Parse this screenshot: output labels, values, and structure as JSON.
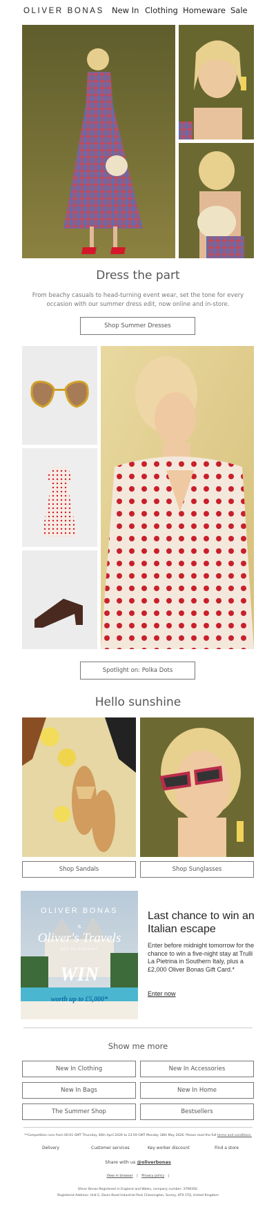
{
  "header": {
    "logo": "OLIVER BONAS",
    "nav": [
      "New In",
      "Clothing",
      "Homeware",
      "Sale"
    ]
  },
  "section1": {
    "heading": "Dress the part",
    "text": "From beachy casuals to head-turning event wear, set the tone for every occasion with our summer dress edit, now online and in-store.",
    "button": "Shop Summer Dresses"
  },
  "section2": {
    "button": "Spotlight on: Polka Dots"
  },
  "section3": {
    "heading": "Hello sunshine",
    "button_left": "Shop Sandals",
    "button_right": "Shop Sunglasses"
  },
  "promo": {
    "banner_brand": "OLIVER BONAS",
    "banner_x": "x",
    "banner_partner": "Oliver's Travels",
    "banner_tagline": "WHY DO ORDINARY",
    "banner_win": "WIN",
    "banner_worth": "worth up to £5,000*",
    "heading": "Last chance to win an Italian escape",
    "text": "Enter before midnight tomorrow for the chance to win a five-night stay at Trulli La Pietrina in Southern Italy, plus a £2,000 Oliver Bonas Gift Card.*",
    "link": "Enter now"
  },
  "more": {
    "heading": "Show me more",
    "buttons": [
      "New In Clothing",
      "New In Accessories",
      "New In Bags",
      "New In Home",
      "The Summer Shop",
      "Bestsellers"
    ]
  },
  "footer": {
    "terms_prefix": "**Competition runs from 00:01 GMT Thursday 30th April 2026 to 23:59 GMT Monday 18th May 2026. Please read the full ",
    "terms_link": "terms and conditions.",
    "links": [
      "Delivery",
      "Customer services",
      "Key worker discount",
      "Find a store"
    ],
    "share_prefix": "Share with us ",
    "share_handle": "@oliverbonas",
    "browser_link": "View in browser",
    "privacy_link": "Privacy policy",
    "separator": "|",
    "registered": "Oliver Bonas Registered in England and Wales, company number: 3799350.",
    "address": "Registered Address: Unit E, Davis Road Industrial Park Chessington, Surrey, KT9 1TQ, United Kingdom"
  },
  "colors": {
    "accent_text": "#555555",
    "border": "#777777",
    "olive_bg": "#6e6a38",
    "polka_red": "#c8202b"
  }
}
